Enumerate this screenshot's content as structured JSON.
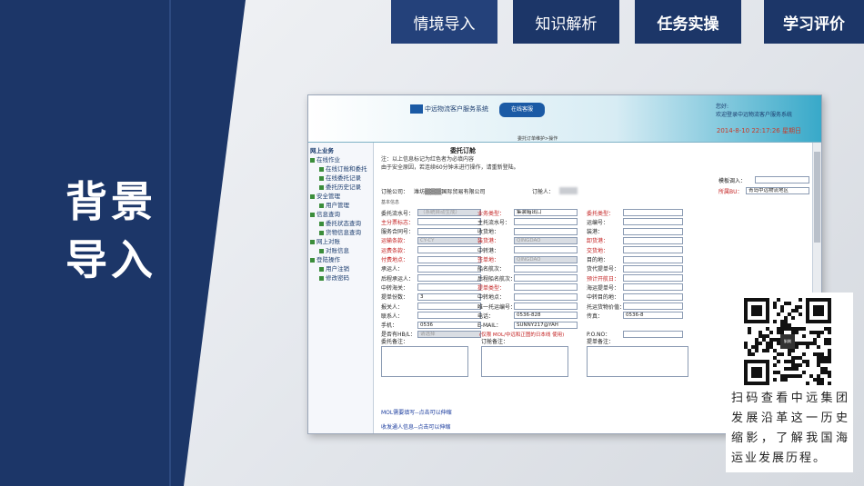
{
  "side_title": [
    "背景",
    "导入"
  ],
  "nav": {
    "tabs": [
      {
        "label": "情境导入"
      },
      {
        "label": "知识解析"
      },
      {
        "label": "任务实操"
      },
      {
        "label": "学习评价"
      }
    ]
  },
  "screenshot": {
    "header": {
      "system_name": "中远物流客户服务系统",
      "online_badge": "在线客服",
      "right_line1": "您好:",
      "right_line2": "欢迎登录中远物流客户服务系统",
      "date": "2014-8-10 22:17:26 星期日"
    },
    "breadcrumb": "委托订单维护>操作",
    "menu": [
      {
        "label": "网上业务",
        "level": "top"
      },
      {
        "label": "在线作业",
        "level": "group"
      },
      {
        "label": "在线订舱和委托",
        "level": "sub"
      },
      {
        "label": "在线委托记录",
        "level": "sub"
      },
      {
        "label": "委托历史记录",
        "level": "sub"
      },
      {
        "label": "安全管理",
        "level": "group"
      },
      {
        "label": "用户管理",
        "level": "sub"
      },
      {
        "label": "信息查询",
        "level": "group"
      },
      {
        "label": "委托状态查询",
        "level": "sub"
      },
      {
        "label": "货物信息查询",
        "level": "sub"
      },
      {
        "label": "网上对账",
        "level": "group"
      },
      {
        "label": "对账信息",
        "level": "sub"
      },
      {
        "label": "登陆操作",
        "level": "group"
      },
      {
        "label": "用户注销",
        "level": "sub"
      },
      {
        "label": "修改密码",
        "level": "sub"
      }
    ],
    "form": {
      "title": "委托订舱",
      "note_line1": "注：以上信息标记为红色者为必填内容",
      "note_line2": "由于安全原因，若连续60分钟未进行操作，请重新登陆。",
      "template_label": "模板调入：",
      "bu_label": "所属BU：",
      "bu_value": "青岛中远物流地区",
      "company_label": "订舱公司：",
      "company_value": "潍坊▒▒▒▒国际贸易有限公司",
      "booker_label": "订舱人：",
      "section_basic": "基本信息",
      "rows": [
        [
          "委托流水号：",
          "（系统自动生成）",
          "业务类型：",
          "集装箱出口",
          "委托类型：",
          ""
        ],
        [
          "主分票标志：",
          "",
          "主托流水号：",
          "",
          "运编号：",
          ""
        ],
        [
          "服务合同号：",
          "",
          "收货地：",
          "",
          "装港：",
          ""
        ],
        [
          "运输条款：",
          "CY-CY",
          "装货港：",
          "QINGDAO",
          "卸货港：",
          ""
        ],
        [
          "运费条款：",
          "",
          "中转港：",
          "",
          "交货地：",
          ""
        ],
        [
          "付费地点：",
          "",
          "签单地：",
          "QINGDAO",
          "目的地：",
          ""
        ],
        [
          "承运人：",
          "",
          "船名航次：",
          "",
          "货代提单号：",
          ""
        ],
        [
          "后程承运人：",
          "",
          "后程船名航次：",
          "",
          "预计开航日：",
          ""
        ],
        [
          "中转海关：",
          "",
          "提单类型：",
          "",
          "海运提单号：",
          ""
        ],
        [
          "提单份数：",
          "3",
          "中转地点：",
          "",
          "中转目的地：",
          ""
        ],
        [
          "报关人：",
          "",
          "唯一托运编号：",
          "",
          "托运货物价值：",
          ""
        ],
        [
          "联系人：",
          "",
          "电话：",
          "0536-828",
          "传真：",
          "0536-8"
        ],
        [
          "手机：",
          "0536",
          "E-MAIL：",
          "SUNNY217@YAH",
          "",
          ""
        ],
        [
          "是否有HB/L：",
          "请选择",
          "",
          "",
          "P.O.NO：",
          ""
        ]
      ],
      "hbl_note": "(仅限 MOL/中远和正图的日本线 使用)",
      "remark_labels": [
        "委托备注：",
        "订舱备注：",
        "提单备注："
      ],
      "mol_link": "MOL需要填写--点击可以伸缩",
      "extra_link": "收发通人信息--点击可以伸缩"
    }
  },
  "qr": {
    "logo_text": "斛剣",
    "caption": "扫码查看中远集团发展沿革这一历史缩影，了解我国海运业发展历程。"
  },
  "colors": {
    "navy": "#1c3668",
    "header_blue": "#38a9c9",
    "required_red": "#c32020"
  }
}
